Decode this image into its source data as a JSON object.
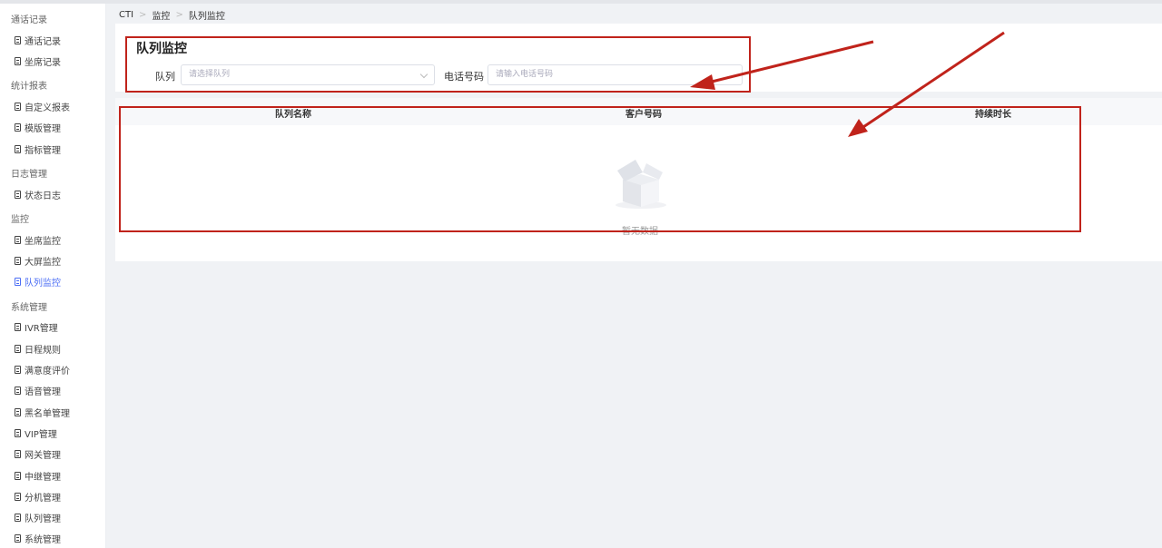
{
  "sidebar": {
    "groups": [
      {
        "label": "通话记录",
        "items": [
          "通话记录",
          "坐席记录"
        ]
      },
      {
        "label": "统计报表",
        "items": [
          "自定义报表",
          "模版管理",
          "指标管理"
        ]
      },
      {
        "label": "日志管理",
        "items": [
          "状态日志"
        ]
      },
      {
        "label": "监控",
        "items": [
          "坐席监控",
          "大屏监控",
          "队列监控"
        ]
      },
      {
        "label": "系统管理",
        "items": [
          "IVR管理",
          "日程规则",
          "满意度评价",
          "语音管理",
          "黑名单管理",
          "VIP管理",
          "网关管理",
          "中继管理",
          "分机管理",
          "队列管理",
          "系统管理"
        ]
      }
    ],
    "active_item": "队列监控"
  },
  "breadcrumb": [
    "CTI",
    "监控",
    "队列监控"
  ],
  "filter": {
    "title": "队列监控",
    "queue_label": "队列",
    "queue_placeholder": "请选择队列",
    "phone_label": "电话号码",
    "phone_placeholder": "请输入电话号码"
  },
  "table": {
    "columns": [
      "队列名称",
      "客户号码",
      "持续时长"
    ],
    "rows": [],
    "empty_text": "暂无数据"
  },
  "colors": {
    "accent": "#4c6ef5",
    "annotation_red": "#c0231b"
  }
}
